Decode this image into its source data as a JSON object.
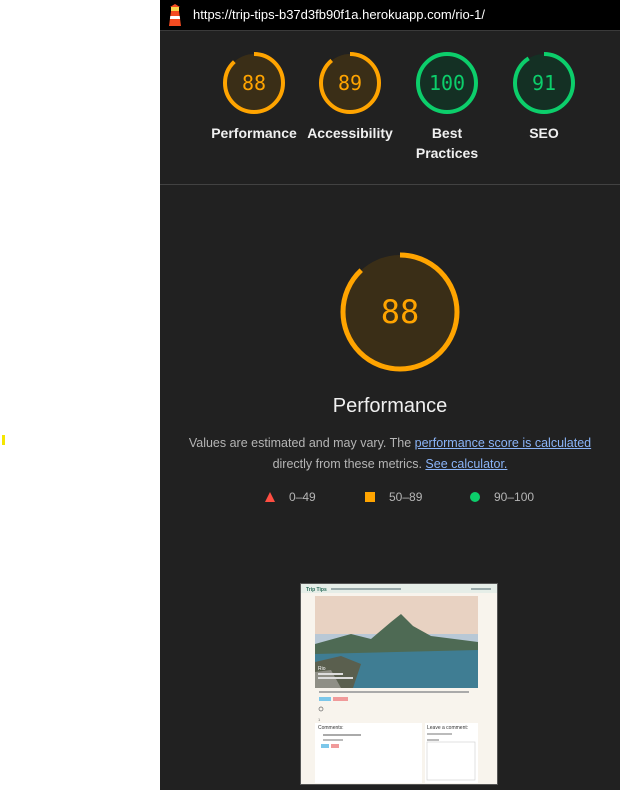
{
  "browser": {
    "url": "https://trip-tips-b37d3fb90f1a.herokuapp.com/rio-1/"
  },
  "categories": [
    {
      "name": "Performance",
      "score": 88,
      "color": "#ffa400",
      "bg": "#3a2e17"
    },
    {
      "name": "Accessibility",
      "score": 89,
      "color": "#ffa400",
      "bg": "#3a2e17"
    },
    {
      "name": "Best Practices",
      "score": 100,
      "color": "#0cce6b",
      "bg": "#143024"
    },
    {
      "name": "SEO",
      "score": 91,
      "color": "#0cce6b",
      "bg": "#143024"
    }
  ],
  "detail": {
    "score": 88,
    "title": "Performance",
    "desc_prefix": "Values are estimated and may vary. The ",
    "desc_link1": "performance score is calculated",
    "desc_middle": " directly from these metrics. ",
    "desc_link2": "See calculator.",
    "color": "#ffa400",
    "bg": "#3a2e17"
  },
  "legend": [
    {
      "shape": "triangle",
      "label": "0–49",
      "color": "#ff4e42"
    },
    {
      "shape": "square",
      "label": "50–89",
      "color": "#ffa400"
    },
    {
      "shape": "circle",
      "label": "90–100",
      "color": "#0cce6b"
    }
  ],
  "thumbnail": {
    "nav_brand": "Trip Tips",
    "hero_title": "Rio",
    "comments_title": "Comments:",
    "leave_comment_title": "Leave a comment:",
    "likes": "1"
  }
}
